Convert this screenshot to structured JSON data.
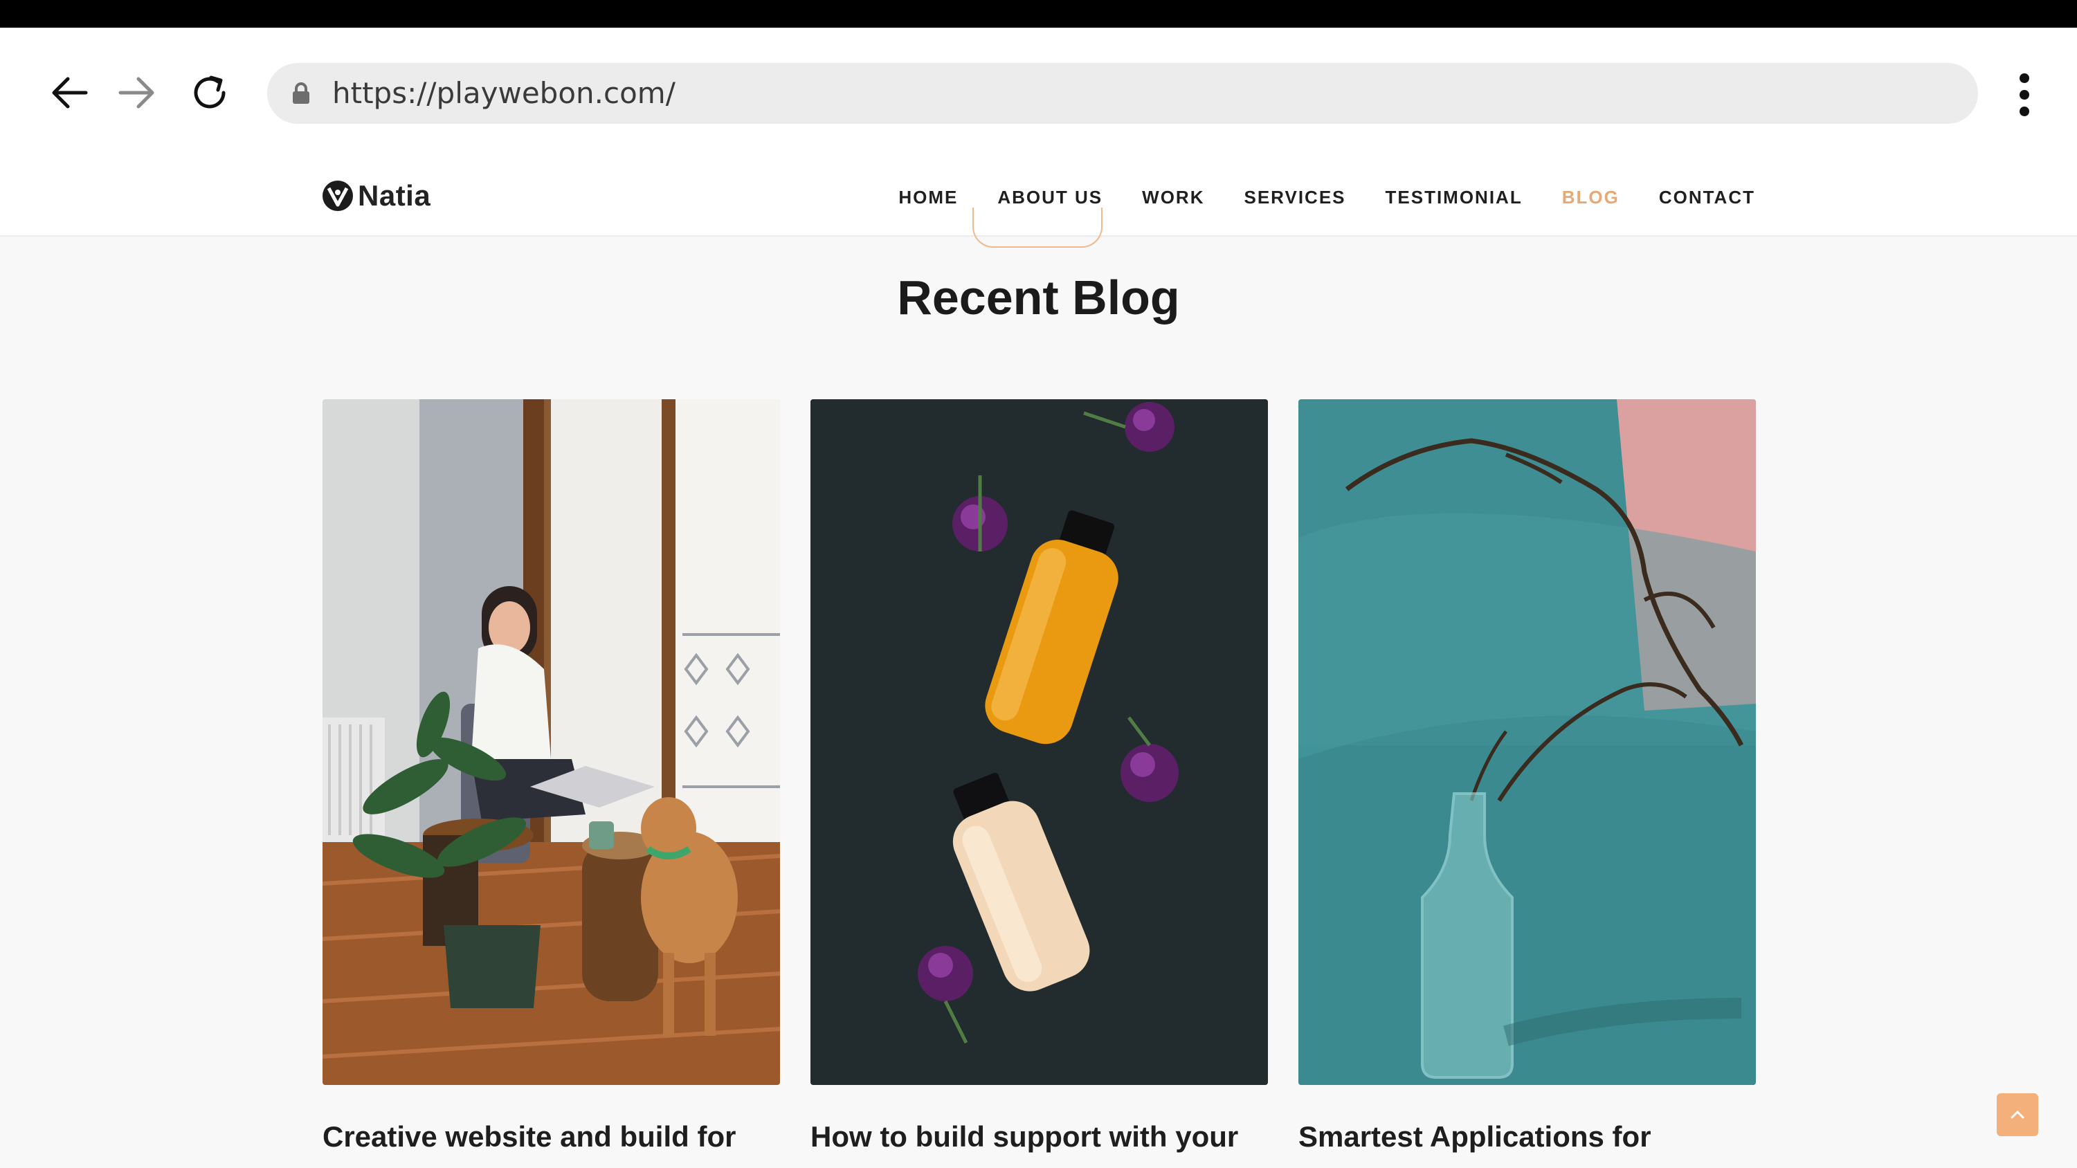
{
  "browser": {
    "url": "https://playwebon.com/",
    "back_icon": "arrow-left-icon",
    "forward_icon": "arrow-right-icon",
    "reload_icon": "reload-icon",
    "menu_icon": "kebab-menu-icon",
    "lock_icon": "lock-icon"
  },
  "site": {
    "logo_text": "Natia",
    "nav": [
      {
        "label": "HOME",
        "active": false
      },
      {
        "label": "ABOUT US",
        "active": false
      },
      {
        "label": "WORK",
        "active": false
      },
      {
        "label": "SERVICES",
        "active": false
      },
      {
        "label": "TESTIMONIAL",
        "active": false
      },
      {
        "label": "BLOG",
        "active": true
      },
      {
        "label": "CONTACT",
        "active": false
      }
    ],
    "accent_color": "#e9a872"
  },
  "blog": {
    "heading": "Recent Blog",
    "posts": [
      {
        "title": "Creative website and build for",
        "image": "woman-laptop-dog-plant-photo"
      },
      {
        "title": "How to build support with your",
        "image": "bottles-purple-flowers-photo"
      },
      {
        "title": "Smartest Applications for",
        "image": "glass-bottle-branch-teal-photo"
      }
    ]
  },
  "scroll_top_icon": "chevron-up-icon"
}
